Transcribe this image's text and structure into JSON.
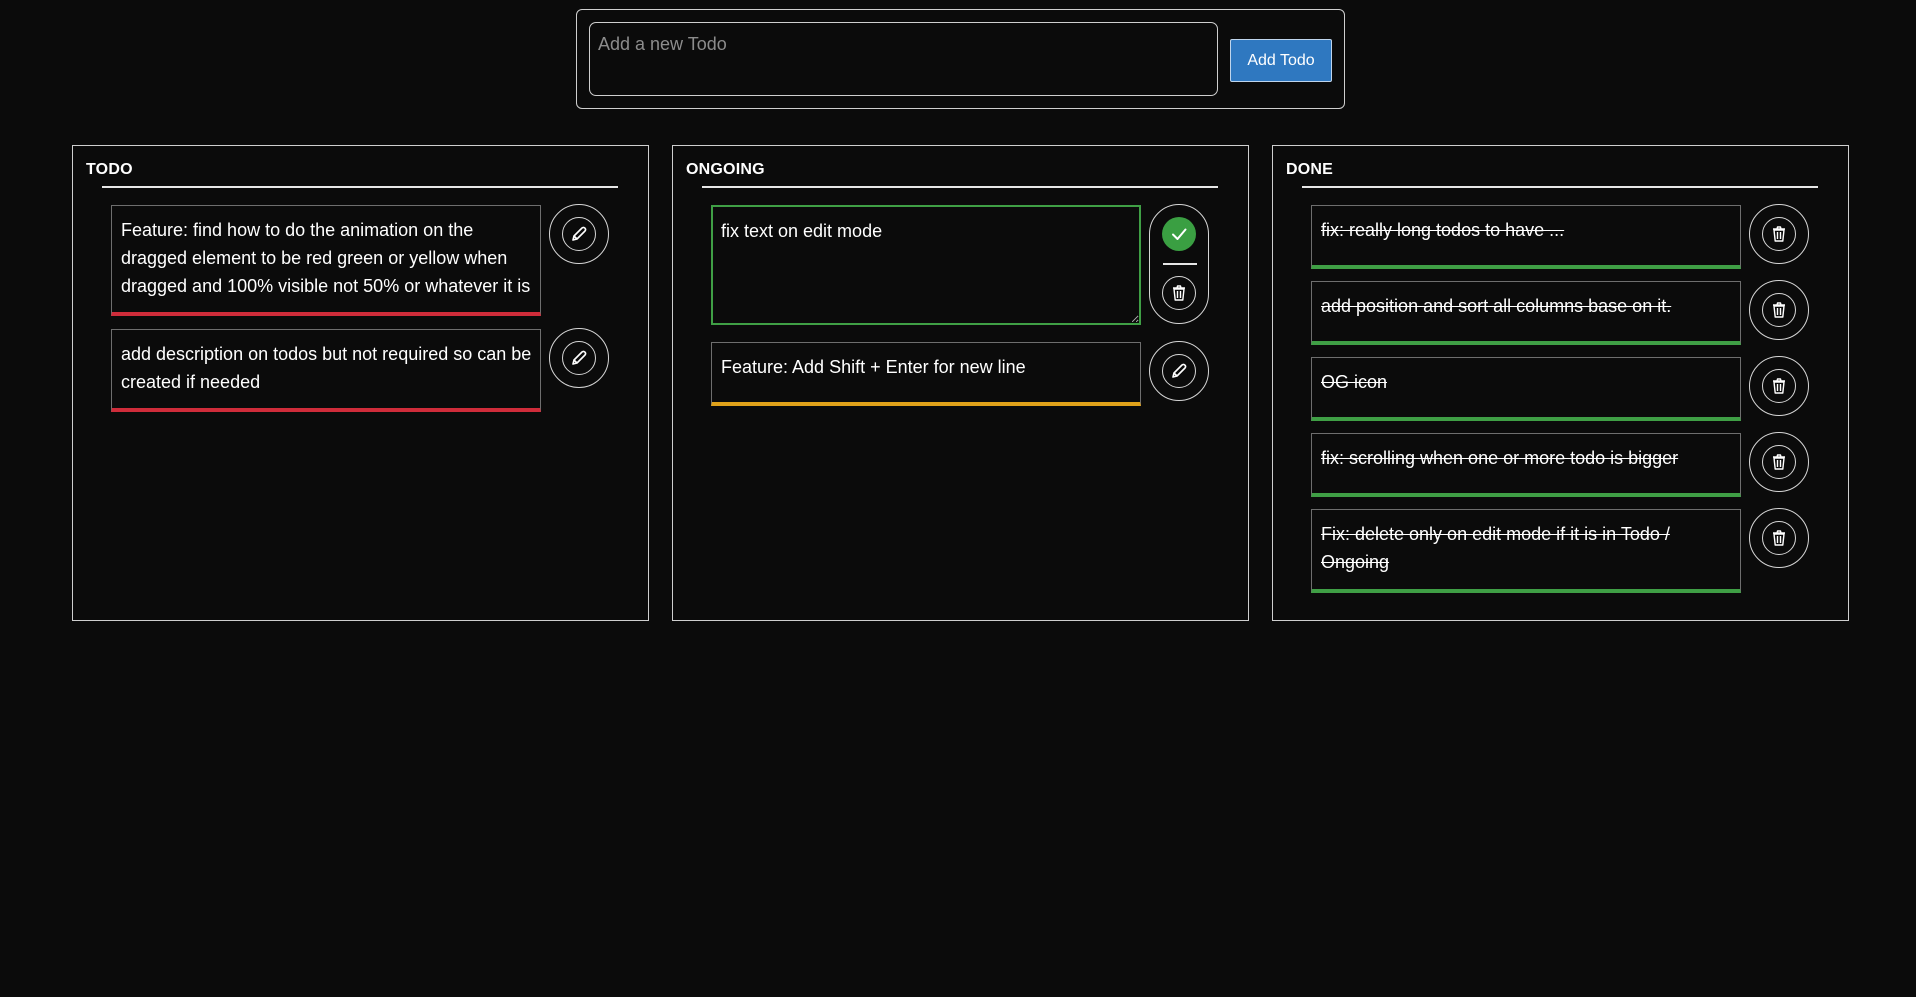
{
  "add_form": {
    "placeholder": "Add a new Todo",
    "button_label": "Add Todo"
  },
  "columns": {
    "todo": {
      "title": "TODO",
      "items": [
        {
          "text": "Feature: find how to do the animation on the dragged element to be red green or yellow when dragged and 100% visible not 50% or whatever it is",
          "status_color": "#cf2c3a",
          "action_icon": "edit-icon"
        },
        {
          "text": "add description on todos but not required so can be created if needed",
          "status_color": "#cf2c3a",
          "action_icon": "edit-icon"
        }
      ]
    },
    "ongoing": {
      "title": "ONGOING",
      "editing_item": {
        "text": "fix text on edit mode",
        "action_icons": [
          "check-icon",
          "trash-icon"
        ]
      },
      "items": [
        {
          "text": "Feature: Add Shift + Enter for new line",
          "status_color": "#e0a21a",
          "action_icon": "edit-icon"
        }
      ]
    },
    "done": {
      "title": "DONE",
      "items": [
        {
          "text": "fix: really long todos to have ...",
          "status_color": "#3f9f45",
          "action_icon": "trash-icon"
        },
        {
          "text": "add position and sort all columns base on it.",
          "status_color": "#3f9f45",
          "action_icon": "trash-icon"
        },
        {
          "text": "OG icon",
          "status_color": "#3f9f45",
          "action_icon": "trash-icon"
        },
        {
          "text": "fix: scrolling when one or more todo is bigger",
          "status_color": "#3f9f45",
          "action_icon": "trash-icon"
        },
        {
          "text": "Fix: delete only on edit mode if it is in Todo / Ongoing",
          "status_color": "#3f9f45",
          "action_icon": "trash-icon"
        }
      ]
    }
  },
  "colors": {
    "background": "#0b0b0b",
    "accent_blue": "#2f78c0",
    "todo_red": "#cf2c3a",
    "ongoing_yellow": "#e0a21a",
    "done_green": "#3f9f45"
  }
}
